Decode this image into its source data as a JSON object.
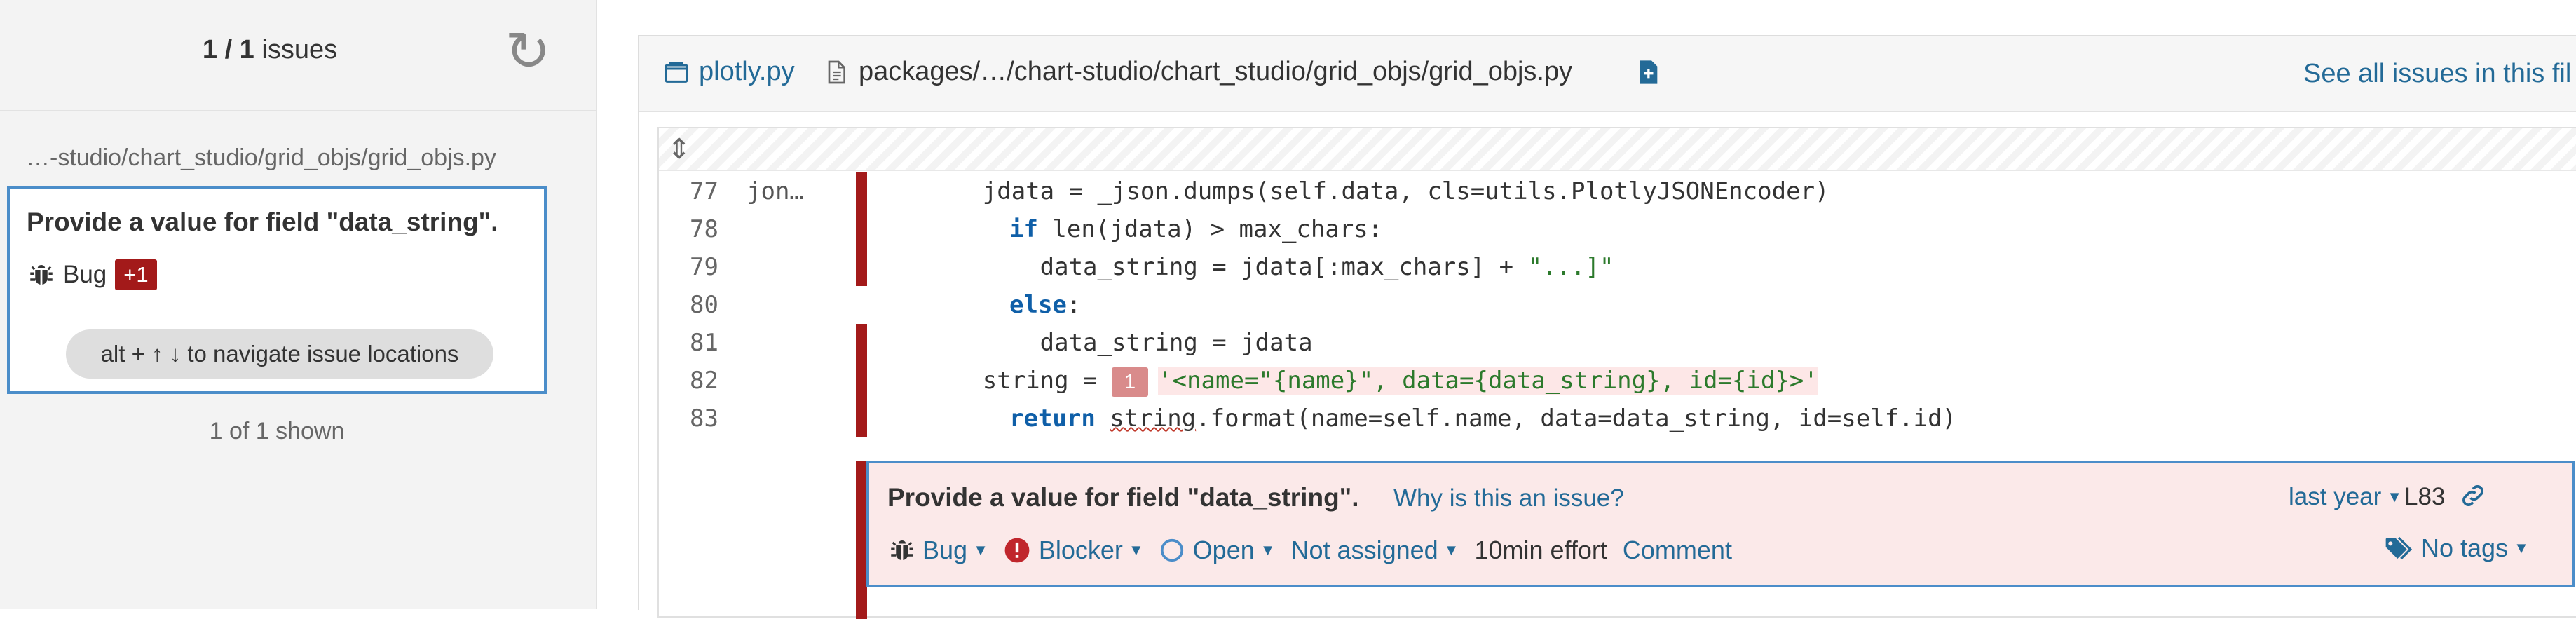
{
  "sidebar": {
    "count_bold": "1 / 1",
    "count_suffix": " issues",
    "refresh_icon": "refresh-icon",
    "file_path": "…-studio/chart_studio/grid_objs/grid_objs.py",
    "issue": {
      "message": "Provide a value for field \"data_string\".",
      "type": "Bug",
      "extra_locations": "+1",
      "nav_hint": "alt + ↑ ↓ to navigate issue locations"
    },
    "shown_text": "1 of 1 shown"
  },
  "header": {
    "project": "plotly.py",
    "file": "packages/…/chart-studio/chart_studio/grid_objs/grid_objs.py",
    "see_all": "See all issues in this fil"
  },
  "code": {
    "lines": [
      {
        "num": "77",
        "scm": "jon…",
        "text": "        jdata = _json.dumps(self.data, cls=utils.PlotlyJSONEncoder)"
      },
      {
        "num": "78",
        "scm": "",
        "kw": "if",
        "text": " len(jdata) > max_chars:"
      },
      {
        "num": "79",
        "scm": "",
        "pre": "            data_string = jdata[:max_chars] + ",
        "str": "\"...]\""
      },
      {
        "num": "80",
        "scm": "",
        "kw": "else",
        "text": ":"
      },
      {
        "num": "81",
        "scm": "",
        "text": "            data_string = jdata"
      },
      {
        "num": "82",
        "scm": "",
        "pre": "        string = ",
        "loc": "1",
        "str": "'<name=\"{name}\", data={data_string}, id={id}>'"
      },
      {
        "num": "83",
        "scm": "",
        "kw": "return",
        "pre": " ",
        "squig": "string",
        "text": ".format(name=self.name, data=data_string, id=self.id)"
      }
    ]
  },
  "issue_box": {
    "message": "Provide a value for field \"data_string\".",
    "why": "Why is this an issue?",
    "date": "last year",
    "line": "L83",
    "type": "Bug",
    "severity": "Blocker",
    "status": "Open",
    "assignee": "Not assigned",
    "effort": "10min effort",
    "comment": "Comment",
    "tags": "No tags"
  },
  "colors": {
    "accent_blue": "#4b8dc9",
    "link": "#236a97",
    "bug_red": "#a31a1a",
    "highlight": "#fde7e7"
  }
}
